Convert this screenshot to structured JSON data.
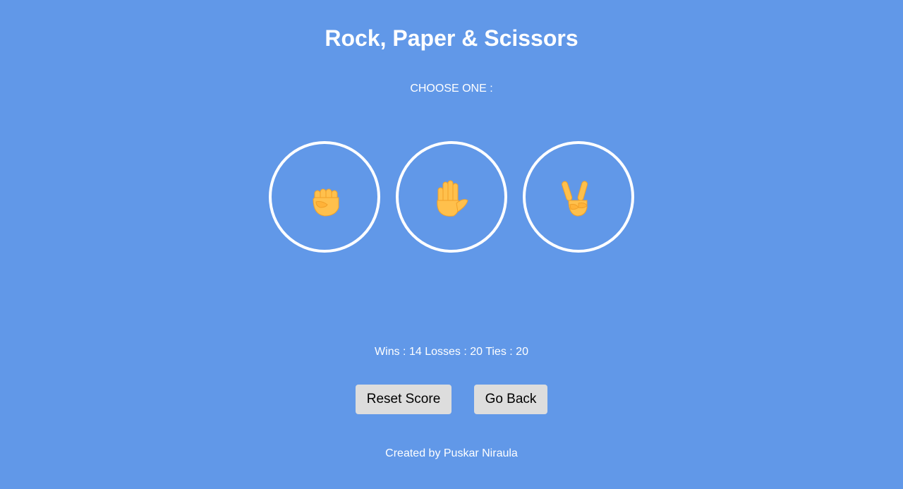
{
  "header": {
    "title": "Rock, Paper & Scissors"
  },
  "prompt": "CHOOSE ONE :",
  "choices": [
    {
      "id": "rock",
      "icon": "raised-fist-icon"
    },
    {
      "id": "paper",
      "icon": "raised-hand-icon"
    },
    {
      "id": "scissors",
      "icon": "victory-hand-icon"
    }
  ],
  "score": {
    "wins_label": "Wins :",
    "wins": "14",
    "losses_label": "Losses :",
    "losses": "20",
    "ties_label": "Ties :",
    "ties": "20"
  },
  "buttons": {
    "reset_label": "Reset Score",
    "back_label": "Go Back"
  },
  "footer": {
    "credit": "Created by Puskar Niraula"
  },
  "colors": {
    "background": "#6198e8",
    "button_bg": "#dddddd",
    "emoji_skin": "#ffc04c",
    "emoji_shade": "#f0a028"
  }
}
